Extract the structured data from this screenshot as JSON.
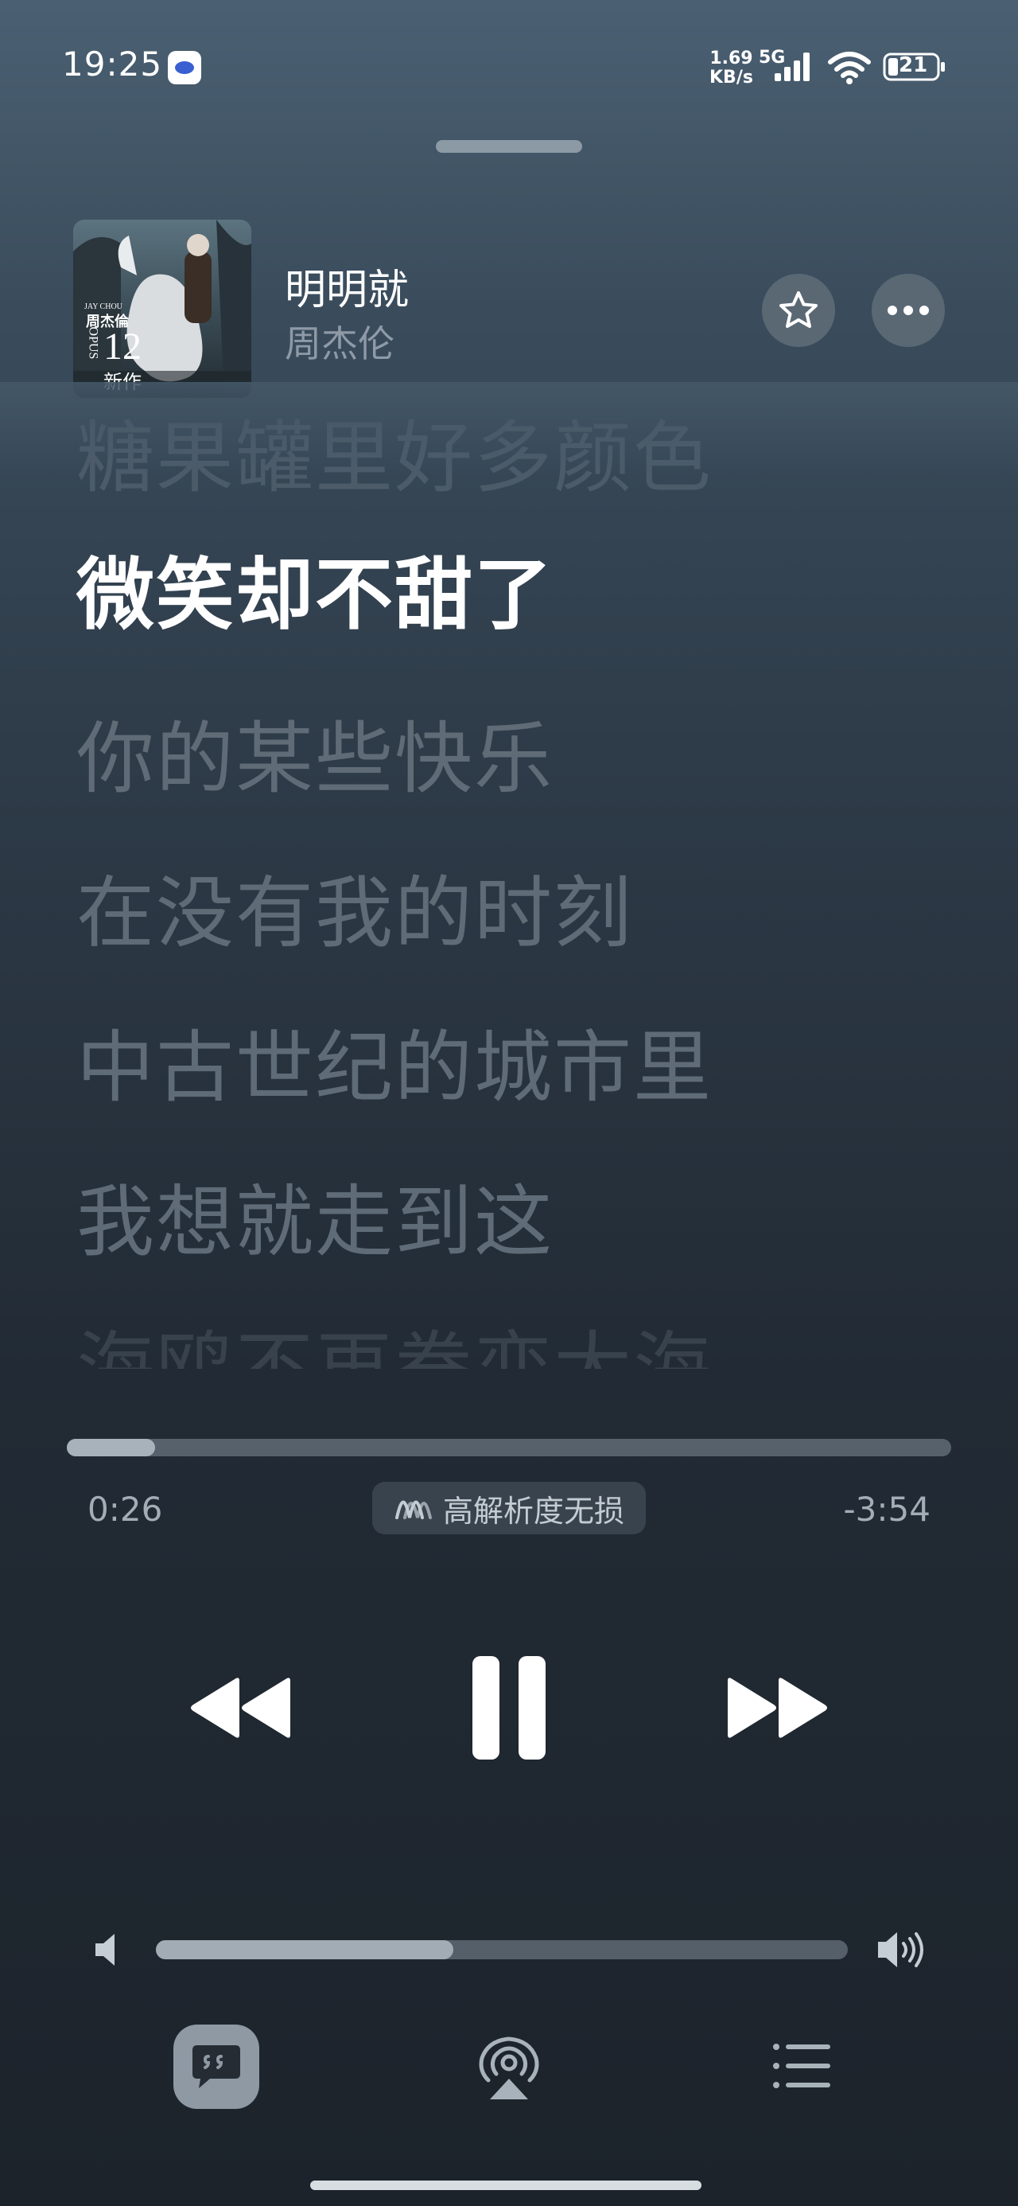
{
  "status_bar": {
    "time": "19:25",
    "net_speed_value": "1.69",
    "net_speed_unit": "KB/s",
    "net_type": "5G",
    "battery": "21"
  },
  "song": {
    "title": "明明就",
    "artist": "周杰伦",
    "cover_text_name": "周杰倫",
    "cover_text_number": "12",
    "cover_text_sub": "新作",
    "cover_text_brand": "JAY CHOU",
    "cover_text_opus": "OPUS"
  },
  "lyrics": [
    "糖果罐里好多颜色",
    "微笑却不甜了",
    "你的某些快乐",
    "在没有我的时刻",
    "中古世纪的城市里",
    "我想就走到这",
    "海鸥不再眷恋大海"
  ],
  "current_lyric_index": 1,
  "playback": {
    "elapsed": "0:26",
    "remaining": "-3:54",
    "progress": 0.1,
    "quality": "高解析度无损"
  },
  "volume": {
    "level": 0.43
  },
  "icons": {
    "favorite": "star-icon",
    "more": "more-dots-icon",
    "prev": "rewind-icon",
    "pause": "pause-icon",
    "next": "fast-forward-icon",
    "lyrics": "lyrics-quote-icon",
    "airplay": "airplay-icon",
    "queue": "list-icon"
  }
}
